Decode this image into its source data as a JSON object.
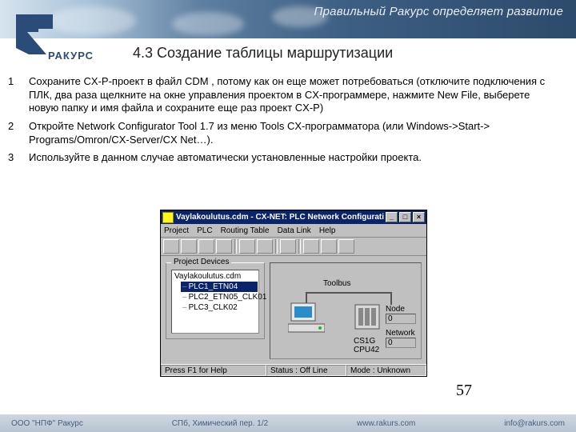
{
  "banner": {
    "slogan": "Правильный Ракурс определяет развитие"
  },
  "logo": {
    "text": "РАКУРС"
  },
  "title": "4.3 Создание таблицы маршрутизации",
  "list": [
    "Сохраните CX-P-проект в файл CDM , потому как он еще может потребоваться (отключите подключения с ПЛК, два раза щелкните на окне управления проектом в CX-программере, нажмите New File, выберете новую папку и имя файла и сохраните еще раз проект CX-P)",
    "Откройте Network Configurator Tool 1.7 из меню Tools CX-программатора (или Windows->Start-> Programs/Omron/CX-Server/CX Net…).",
    "Используйте в данном случае автоматически установленные настройки проекта."
  ],
  "screenshot": {
    "title": "Vaylakoulutus.cdm - CX-NET: PLC Network Configuration Tool",
    "menus": [
      "Project",
      "PLC",
      "Routing Table",
      "Data Link",
      "Help"
    ],
    "devices_group_label": "Project Devices",
    "devices_root": "Vaylakoulutus.cdm",
    "devices": [
      "PLC1_ETN04",
      "PLC2_ETN05_CLK01",
      "PLC3_CLK02"
    ],
    "toolbus_label": "Toolbus",
    "plc_label": "CS1G\nCPU42",
    "node_label": "Node",
    "node_value": "0",
    "network_label": "Network",
    "network_value": "0",
    "status_help": "Press F1 for Help",
    "status_status": "Status : Off Line",
    "status_mode": "Mode : Unknown"
  },
  "page_number": "57",
  "footer": {
    "company": "ООО \"НПФ\" Ракурс",
    "address": "СПб, Химический пер. 1/2",
    "site": "www.rakurs.com",
    "email": "info@rakurs.com"
  }
}
